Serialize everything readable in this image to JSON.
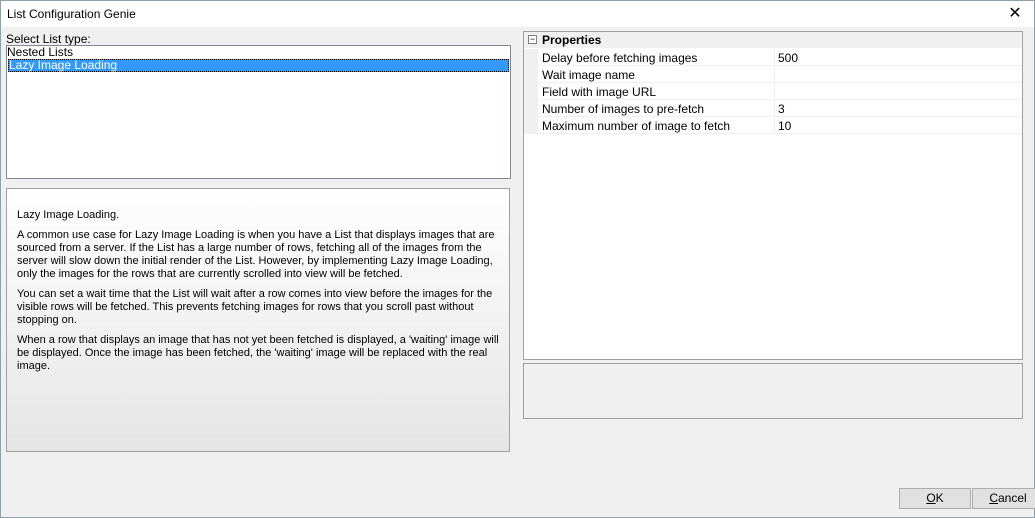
{
  "window": {
    "title": "List Configuration Genie",
    "close_glyph": "✕"
  },
  "list_type": {
    "label": "Select List type:",
    "items": [
      {
        "label": "Nested Lists",
        "selected": false
      },
      {
        "label": "Lazy Image Loading",
        "selected": true
      }
    ]
  },
  "description": {
    "paragraphs": [
      "Lazy Image Loading.",
      "A common use case for Lazy Image Loading is when you have a List that displays images that are sourced from a server. If the List has a large number of rows, fetching all of the images from the server will slow down the initial render of the List. However, by implementing Lazy Image Loading, only the images for the rows that are currently scrolled into view will be fetched.",
      "You can set a wait time that the List will wait after a row comes into view before the images for the visible rows will be fetched. This prevents fetching images for rows that you scroll past without stopping on.",
      "When a row that displays an image that has not yet been fetched is displayed, a 'waiting' image will be displayed. Once the image has been fetched, the 'waiting' image will be replaced with the real image."
    ]
  },
  "properties": {
    "category": "Properties",
    "toggle_glyph": "−",
    "rows": [
      {
        "name": "Delay before fetching images",
        "value": "500"
      },
      {
        "name": "Wait image name",
        "value": ""
      },
      {
        "name": "Field with image URL",
        "value": ""
      },
      {
        "name": "Number of images to pre-fetch",
        "value": "3"
      },
      {
        "name": "Maximum number of image to fetch",
        "value": "10"
      }
    ]
  },
  "buttons": {
    "ok": {
      "mnemonic": "O",
      "rest": "K"
    },
    "cancel": {
      "mnemonic": "C",
      "rest": "ancel"
    }
  }
}
